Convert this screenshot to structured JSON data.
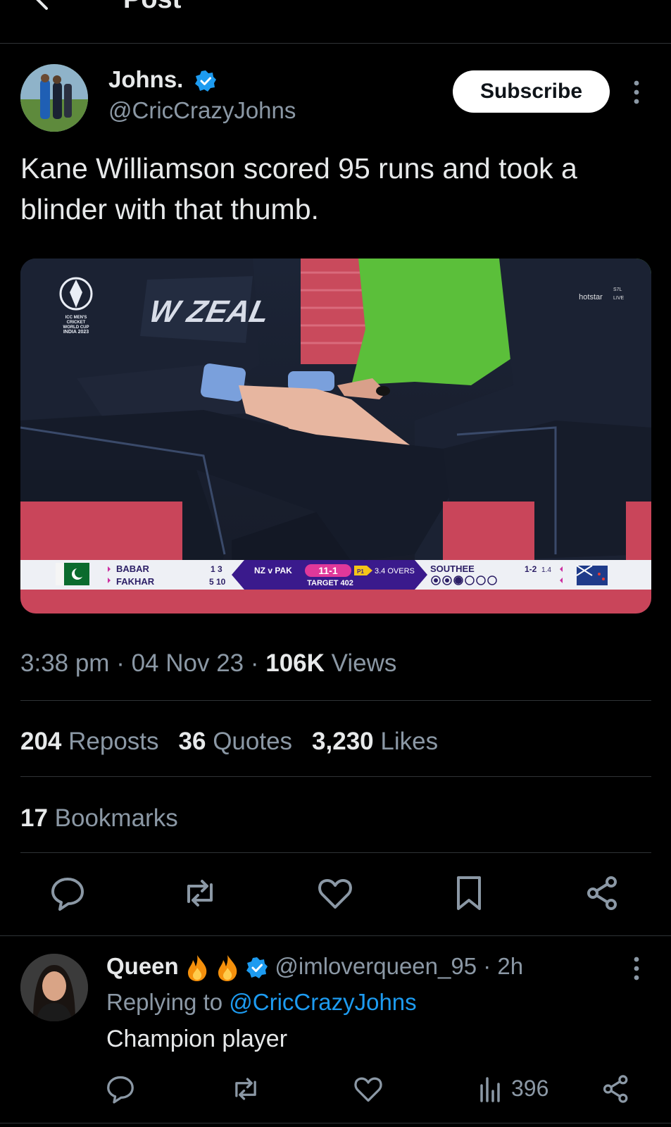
{
  "header": {
    "title": "Post"
  },
  "post": {
    "author_name": "Johns.",
    "author_handle": "@CricCrazyJohns",
    "subscribe_label": "Subscribe",
    "text": "Kane Williamson scored 95 runs and took a blinder with that thumb.",
    "time": "3:38 pm",
    "sep": " · ",
    "date": "04 Nov 23",
    "views_count": "106K",
    "views_label": " Views",
    "reposts_count": "204",
    "reposts_label": " Reposts",
    "quotes_count": "36",
    "quotes_label": " Quotes",
    "likes_count": "3,230",
    "likes_label": " Likes",
    "bookmarks_count": "17",
    "bookmarks_label": " Bookmarks"
  },
  "media": {
    "event_logo_text": [
      "ICC MEN'S",
      "CRICKET",
      "WORLD CUP",
      "INDIA 2023"
    ],
    "broadcaster": "hotstar",
    "broadcaster_badge": [
      "S7L",
      "LIVE"
    ],
    "shirt_text": "W ZEAL",
    "scorebar": {
      "batter1": "BABAR",
      "batter1_score": "1 3",
      "batter2": "FAKHAR",
      "batter2_score": "5 10",
      "match": "NZ v PAK",
      "score": "11-1",
      "p_badge": "P1",
      "overs": "3.4 OVERS",
      "target": "TARGET 402",
      "bowler": "SOUTHEE",
      "bowler_figures": "1-2",
      "bowler_overs": "1.4"
    }
  },
  "reply": {
    "name": "Queen",
    "handle": "@imloverqueen_95",
    "time": "2h",
    "replying_prefix": "Replying to ",
    "replying_to": "@CricCrazyJohns",
    "text": "Champion player",
    "views": "396"
  },
  "colors": {
    "accent": "#1d9bf0",
    "background": "#000000",
    "text": "#e7e9ea",
    "muted": "#8b98a5",
    "divider": "#2f3336"
  }
}
